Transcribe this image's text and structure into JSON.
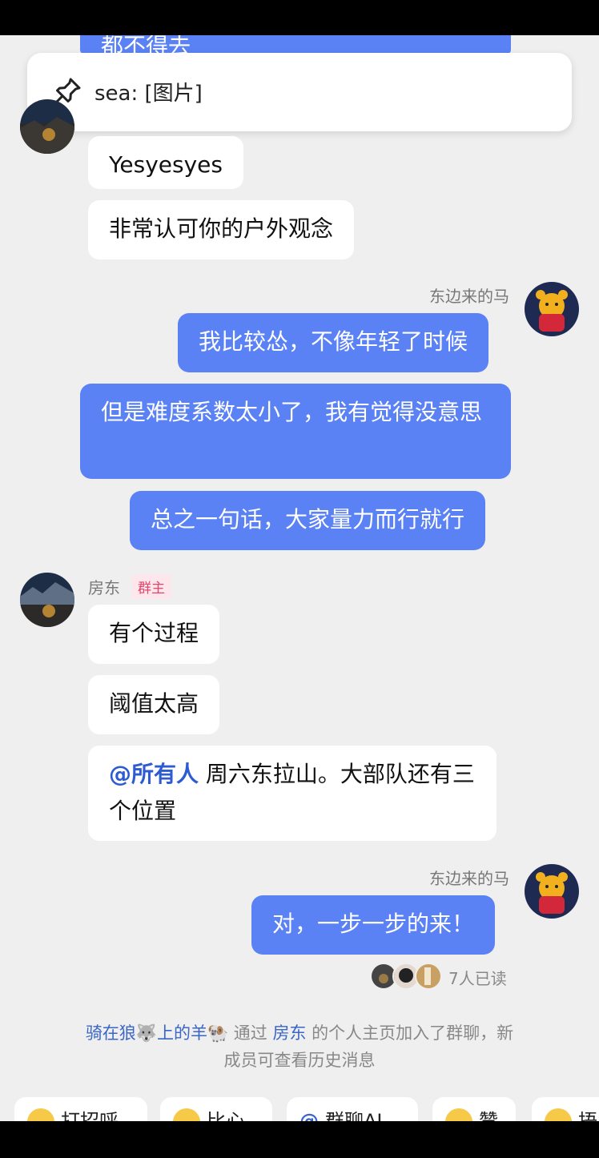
{
  "cutoff_message": "都不得去",
  "pinned": {
    "text": "sea: [图片]"
  },
  "messages_a": [
    "Yesyesyes",
    "非常认可你的户外观念"
  ],
  "me_1": {
    "sender": "东边来的马",
    "messages": [
      "我比较怂，不像年轻了时候",
      "但是难度系数太小了，我有觉得没意思",
      "总之一句话，大家量力而行就行"
    ]
  },
  "landlord": {
    "sender": "房东",
    "badge": "群主",
    "messages": [
      "有个过程",
      "阈值太高"
    ],
    "mention": "@所有人",
    "mention_text": "周六东拉山。大部队还有三个位置"
  },
  "me_2": {
    "sender": "东边来的马",
    "message": "对，一步一步的来！"
  },
  "read_receipt": "7人已读",
  "system_message": {
    "user": "骑在狼🐺上的羊🐏",
    "via": "通过",
    "host": "房东",
    "rest": "的个人主页加入了群聊，新成员可查看历史消息"
  },
  "quick_replies": [
    "打招呼",
    "比心",
    "群聊AI",
    "赞",
    "捂"
  ],
  "colors": {
    "my_bubble": "#5b82f5",
    "background": "#efefef",
    "badge": "#e3466a"
  }
}
